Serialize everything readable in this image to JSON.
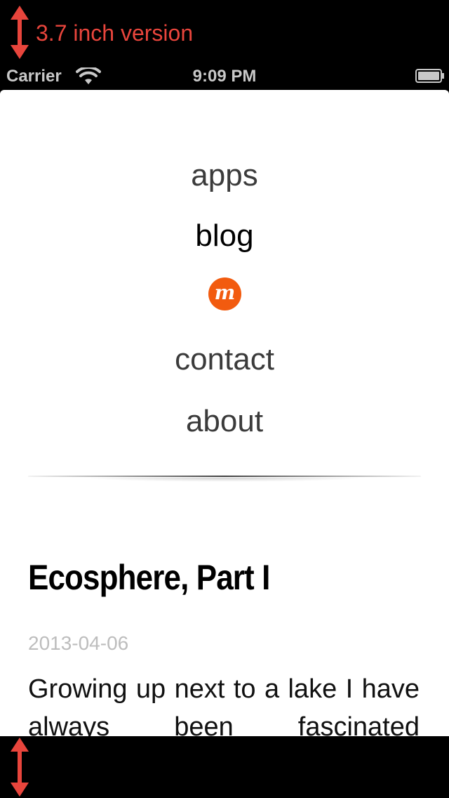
{
  "annotation": {
    "label": "3.7 inch version",
    "color": "#e8453c"
  },
  "status_bar": {
    "carrier": "Carrier",
    "time": "9:09 PM",
    "wifi_icon": "wifi-icon",
    "battery_icon": "battery-icon"
  },
  "nav": {
    "items": [
      {
        "label": "apps",
        "active": false
      },
      {
        "label": "blog",
        "active": true
      },
      {
        "label": "contact",
        "active": false
      },
      {
        "label": "about",
        "active": false
      }
    ],
    "logo": {
      "glyph": "m",
      "color": "#f25b0f"
    }
  },
  "post": {
    "title": "Ecosphere, Part I",
    "date": "2013-04-06",
    "body": "Growing up next to a lake I have always been fascinated"
  }
}
